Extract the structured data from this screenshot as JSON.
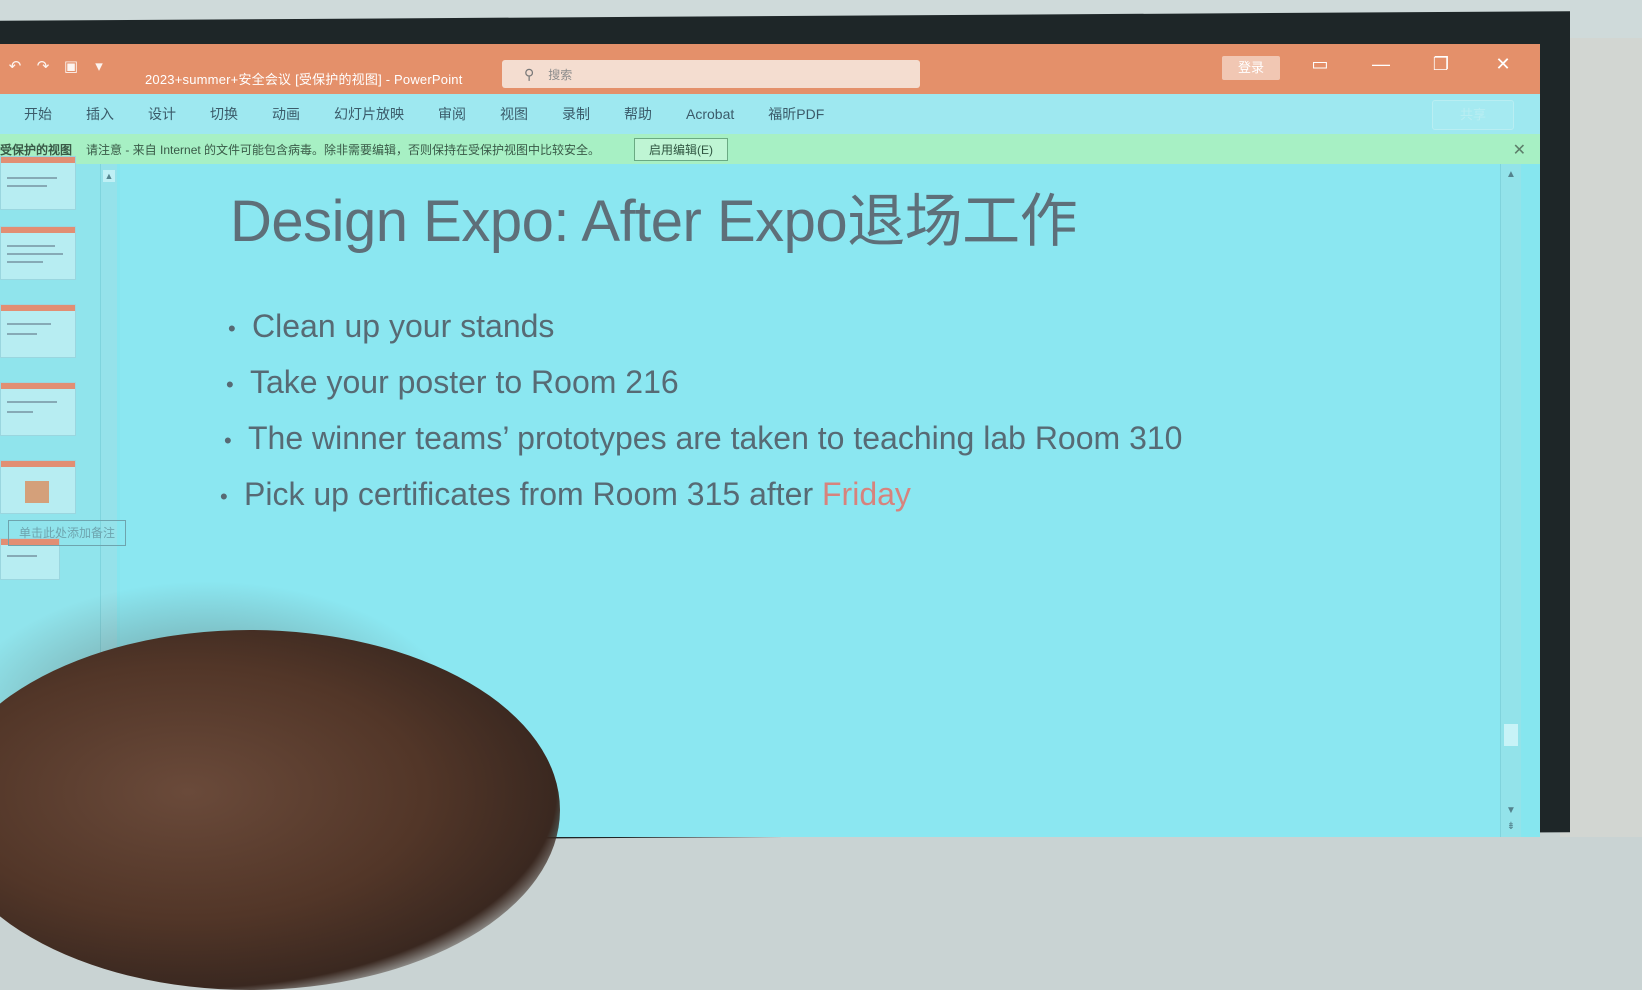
{
  "window": {
    "title": "2023+summer+安全会议 [受保护的视图] - PowerPoint",
    "search_placeholder": "搜索",
    "login_label": "登录",
    "share_label": "共享",
    "minimize_glyph": "—",
    "maximize_glyph": "❐",
    "close_glyph": "✕"
  },
  "menu": {
    "items": [
      "开始",
      "插入",
      "设计",
      "切换",
      "动画",
      "幻灯片放映",
      "审阅",
      "视图",
      "录制",
      "帮助",
      "Acrobat",
      "福昕PDF"
    ]
  },
  "protected_view": {
    "label": "受保护的视图",
    "message": "请注意 - 来自 Internet 的文件可能包含病毒。除非需要编辑，否则保持在受保护视图中比较安全。",
    "enable_button": "启用编辑(E)",
    "close_glyph": "✕"
  },
  "slide": {
    "title": "Design Expo: After Expo退场工作",
    "bullets": [
      {
        "text": "Clean up your stands"
      },
      {
        "text": "Take your poster to Room 216"
      },
      {
        "text": "The winner teams’ prototypes are taken to teaching lab Room 310"
      },
      {
        "text": "Pick up certificates from Room 315 after ",
        "highlight": "Friday",
        "highlight_color": "#d7837d"
      }
    ],
    "bullet_glyph": "•"
  },
  "notes": {
    "comment_label": "单击此处添加备注"
  },
  "colors": {
    "titlebar": "#e4906a",
    "ribbon": "#9ee8f0",
    "protect_bar": "#a7f0c4",
    "slide_bg": "#8be7f1",
    "text": "#576a74",
    "accent_red": "#d7837d"
  }
}
